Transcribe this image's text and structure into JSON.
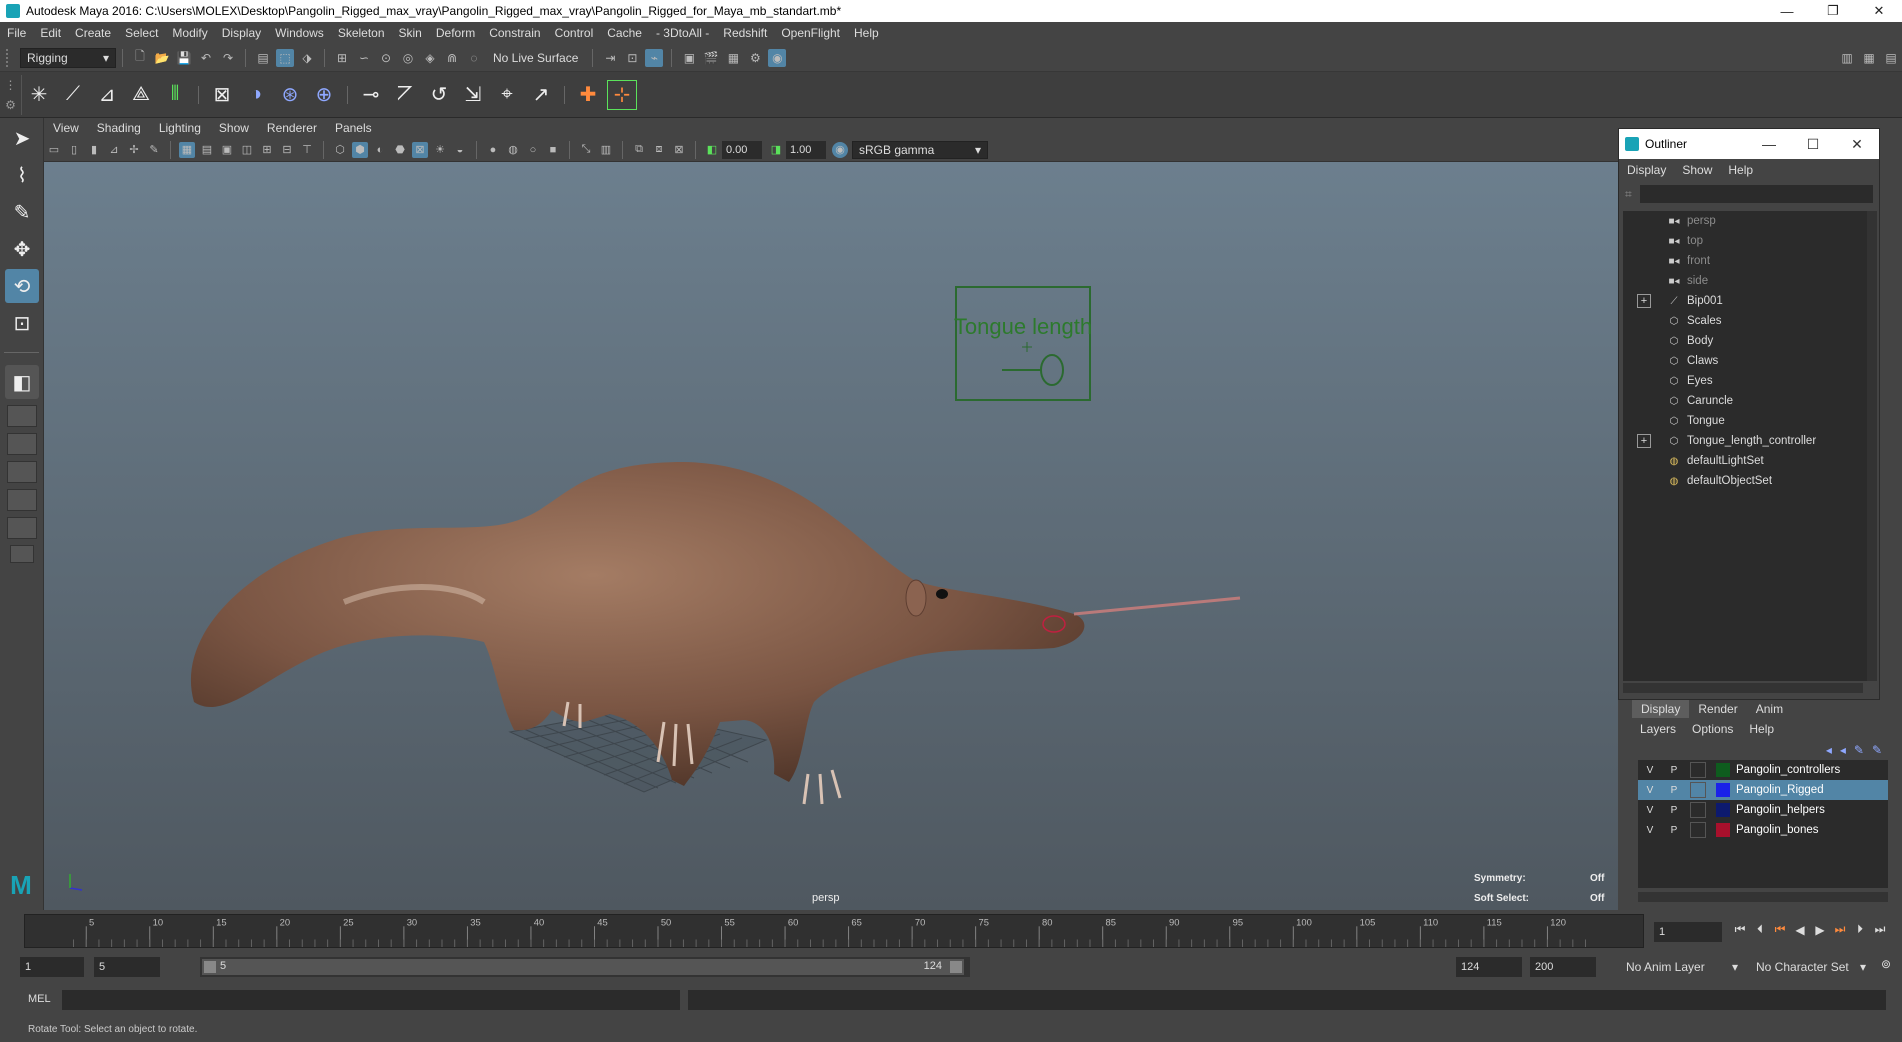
{
  "window": {
    "title": "Autodesk Maya 2016: C:\\Users\\MOLEX\\Desktop\\Pangolin_Rigged_max_vray\\Pangolin_Rigged_max_vray\\Pangolin_Rigged_for_Maya_mb_standart.mb*"
  },
  "menubar": [
    "File",
    "Edit",
    "Create",
    "Select",
    "Modify",
    "Display",
    "Windows",
    "Skeleton",
    "Skin",
    "Deform",
    "Constrain",
    "Control",
    "Cache",
    "- 3DtoAll -",
    "Redshift",
    "OpenFlight",
    "Help"
  ],
  "status_line": {
    "menu_set": "Rigging",
    "live_surface": "No Live Surface"
  },
  "viewport": {
    "menus": [
      "View",
      "Shading",
      "Lighting",
      "Show",
      "Renderer",
      "Panels"
    ],
    "exposure": "0.00",
    "gamma": "1.00",
    "color_space": "sRGB gamma",
    "camera_label": "persp",
    "controller_label": "Tongue length",
    "symmetry_label": "Symmetry:",
    "symmetry_value": "Off",
    "soft_select_label": "Soft Select:",
    "soft_select_value": "Off"
  },
  "outliner": {
    "title": "Outliner",
    "menus": [
      "Display",
      "Show",
      "Help"
    ],
    "items": [
      {
        "label": "persp",
        "icon": "camera-icon",
        "dim": true,
        "expandable": false
      },
      {
        "label": "top",
        "icon": "camera-icon",
        "dim": true,
        "expandable": false
      },
      {
        "label": "front",
        "icon": "camera-icon",
        "dim": true,
        "expandable": false
      },
      {
        "label": "side",
        "icon": "camera-icon",
        "dim": true,
        "expandable": false
      },
      {
        "label": "Bip001",
        "icon": "joint-icon",
        "dim": false,
        "expandable": true
      },
      {
        "label": "Scales",
        "icon": "mesh-icon",
        "dim": false,
        "expandable": false
      },
      {
        "label": "Body",
        "icon": "mesh-icon",
        "dim": false,
        "expandable": false
      },
      {
        "label": "Claws",
        "icon": "mesh-icon",
        "dim": false,
        "expandable": false
      },
      {
        "label": "Eyes",
        "icon": "mesh-icon",
        "dim": false,
        "expandable": false
      },
      {
        "label": "Caruncle",
        "icon": "mesh-icon",
        "dim": false,
        "expandable": false
      },
      {
        "label": "Tongue",
        "icon": "mesh-icon",
        "dim": false,
        "expandable": false
      },
      {
        "label": "Tongue_length_controller",
        "icon": "mesh-icon",
        "dim": false,
        "expandable": true
      },
      {
        "label": "defaultLightSet",
        "icon": "set-icon",
        "dim": false,
        "expandable": false
      },
      {
        "label": "defaultObjectSet",
        "icon": "set-icon",
        "dim": false,
        "expandable": false
      }
    ]
  },
  "layer_editor": {
    "tabs": [
      "Display",
      "Render",
      "Anim"
    ],
    "menus": [
      "Layers",
      "Options",
      "Help"
    ],
    "visible_flag": "V",
    "playback_flag": "P",
    "layers": [
      {
        "name": "Pangolin_controllers",
        "color": "#0e5c1e",
        "selected": false
      },
      {
        "name": "Pangolin_Rigged",
        "color": "#1a22e8",
        "selected": true
      },
      {
        "name": "Pangolin_helpers",
        "color": "#0d1a6e",
        "selected": false
      },
      {
        "name": "Pangolin_bones",
        "color": "#a8102c",
        "selected": false
      }
    ]
  },
  "timeline": {
    "ticks": [
      "5",
      "10",
      "15",
      "20",
      "25",
      "30",
      "35",
      "40",
      "45",
      "50",
      "55",
      "60",
      "65",
      "70",
      "75",
      "80",
      "85",
      "90",
      "95",
      "100",
      "105",
      "110",
      "115",
      "120"
    ],
    "current_frame": "1"
  },
  "range": {
    "start": "1",
    "playback_start": "5",
    "slider_start": "5",
    "slider_end": "124",
    "playback_end": "124",
    "end": "200",
    "anim_layer": "No Anim Layer",
    "character_set": "No Character Set"
  },
  "command_line": {
    "mode": "MEL"
  },
  "help_line": "Rotate Tool: Select an object to rotate."
}
